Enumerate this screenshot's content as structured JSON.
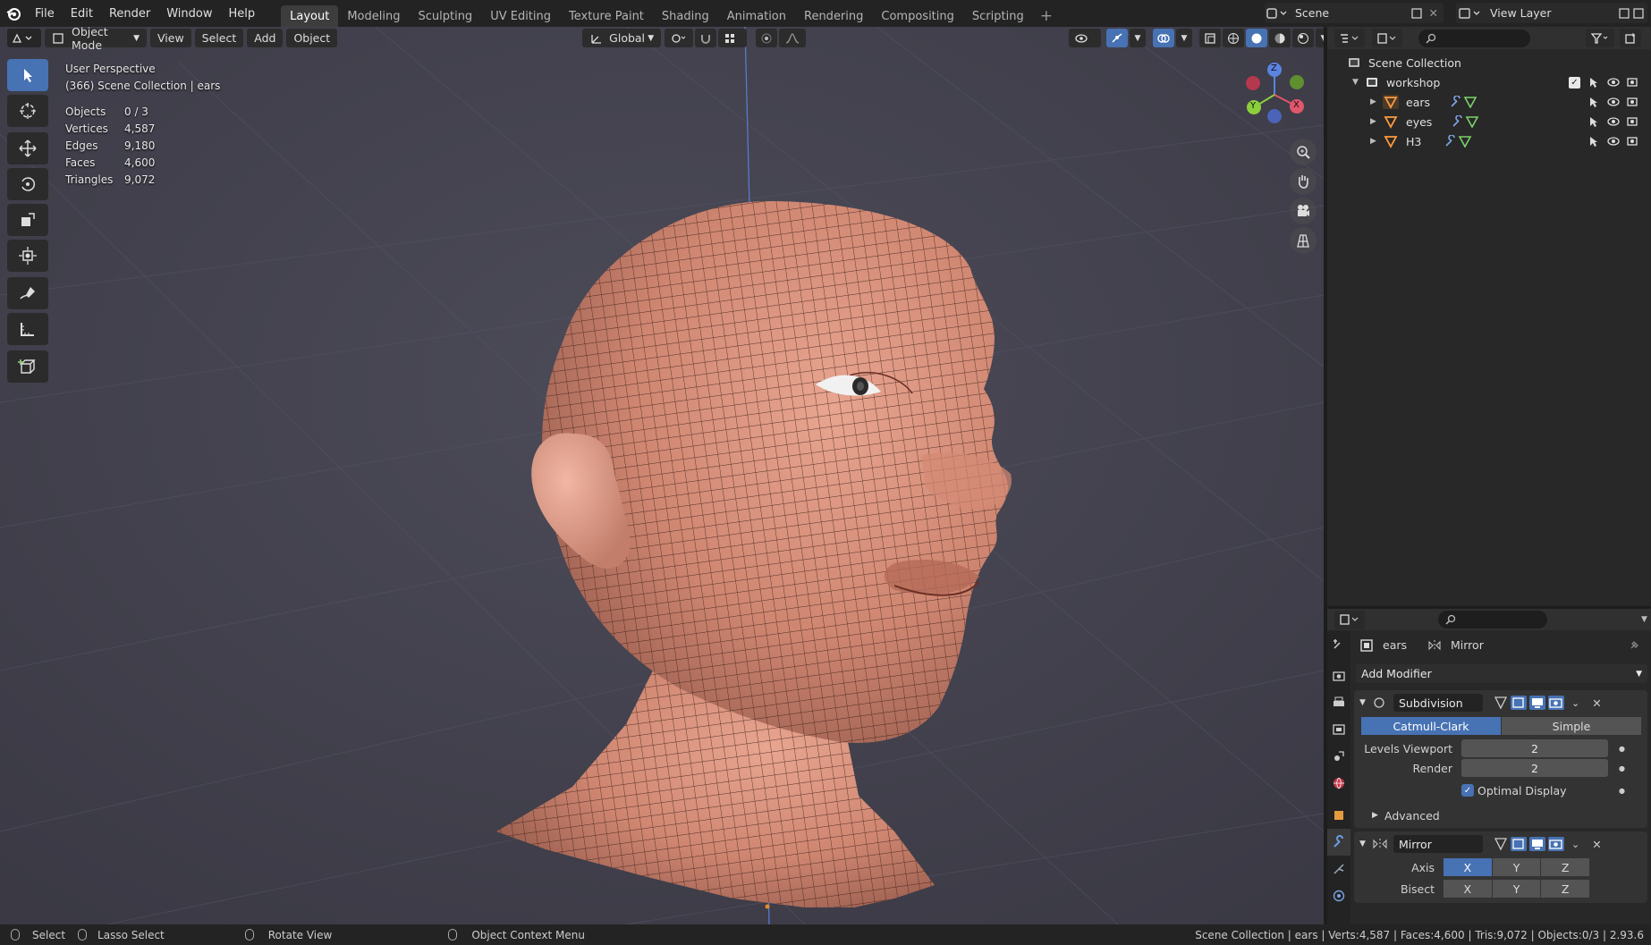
{
  "topbar": {
    "menus": [
      "File",
      "Edit",
      "Render",
      "Window",
      "Help"
    ],
    "workspaces": [
      "Layout",
      "Modeling",
      "Sculpting",
      "UV Editing",
      "Texture Paint",
      "Shading",
      "Animation",
      "Rendering",
      "Compositing",
      "Scripting"
    ],
    "active_workspace": "Layout",
    "scene": "Scene",
    "view_layer": "View Layer"
  },
  "viewport": {
    "mode": "Object Mode",
    "menus": [
      "View",
      "Select",
      "Add",
      "Object"
    ],
    "transform_orientation": "Global",
    "perspective": "User Perspective",
    "collection_info": "(366) Scene Collection | ears",
    "stats": [
      {
        "k": "Objects",
        "v": "0 / 3"
      },
      {
        "k": "Vertices",
        "v": "4,587"
      },
      {
        "k": "Edges",
        "v": "9,180"
      },
      {
        "k": "Faces",
        "v": "4,600"
      },
      {
        "k": "Triangles",
        "v": "9,072"
      }
    ],
    "gizmo": {
      "x": "X",
      "y": "Y",
      "z": "Z"
    }
  },
  "outliner": {
    "root": "Scene Collection",
    "collection": "workshop",
    "objects": [
      "ears",
      "eyes",
      "H3"
    ]
  },
  "properties": {
    "object": "ears",
    "active_modifier": "Mirror",
    "add_modifier": "Add Modifier",
    "subdivision": {
      "name": "Subdivision",
      "types": [
        "Catmull-Clark",
        "Simple"
      ],
      "levels_viewport_label": "Levels Viewport",
      "levels_viewport": "2",
      "render_label": "Render",
      "render": "2",
      "optimal_display": "Optimal Display",
      "advanced": "Advanced"
    },
    "mirror": {
      "name": "Mirror",
      "axis_label": "Axis",
      "bisect_label": "Bisect",
      "axes": [
        "X",
        "Y",
        "Z"
      ]
    }
  },
  "statusbar": {
    "select": "Select",
    "lasso": "Lasso Select",
    "rotate": "Rotate View",
    "context": "Object Context Menu",
    "info": "Scene Collection | ears | Verts:4,587 | Faces:4,600 | Tris:9,072 | Objects:0/3 | 2.93.6"
  }
}
